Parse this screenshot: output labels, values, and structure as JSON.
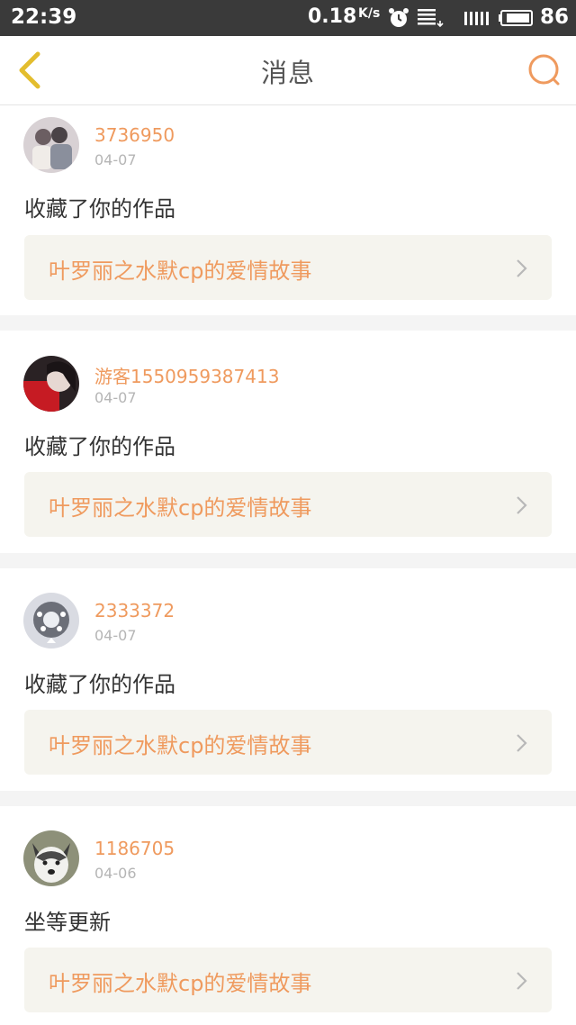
{
  "status_bar": {
    "time": "22:39",
    "speed": "0.18",
    "speed_unit": "K/s",
    "battery": "86",
    "icons": [
      "alarm-icon",
      "notification-icon",
      "signal-icon",
      "battery-icon"
    ]
  },
  "nav": {
    "title": "消息",
    "back_icon": "chevron-left-icon",
    "search_icon": "search-icon"
  },
  "colors": {
    "accent": "#ef9a5e",
    "back_icon": "#e3bd2e",
    "status_bar_bg": "#3a3a3a",
    "link_bg": "#f5f4ee",
    "separator": "#f4f4f4"
  },
  "messages": [
    {
      "user": "3736950",
      "date": "04-07",
      "text": "收藏了你的作品",
      "work": "叶罗丽之水默cp的爱情故事"
    },
    {
      "user": "游客1550959387413",
      "date": "04-07",
      "text": "收藏了你的作品",
      "work": "叶罗丽之水默cp的爱情故事"
    },
    {
      "user": "2333372",
      "date": "04-07",
      "text": "收藏了你的作品",
      "work": "叶罗丽之水默cp的爱情故事"
    },
    {
      "user": "1186705",
      "date": "04-06",
      "text": "坐等更新",
      "work": "叶罗丽之水默cp的爱情故事"
    }
  ]
}
